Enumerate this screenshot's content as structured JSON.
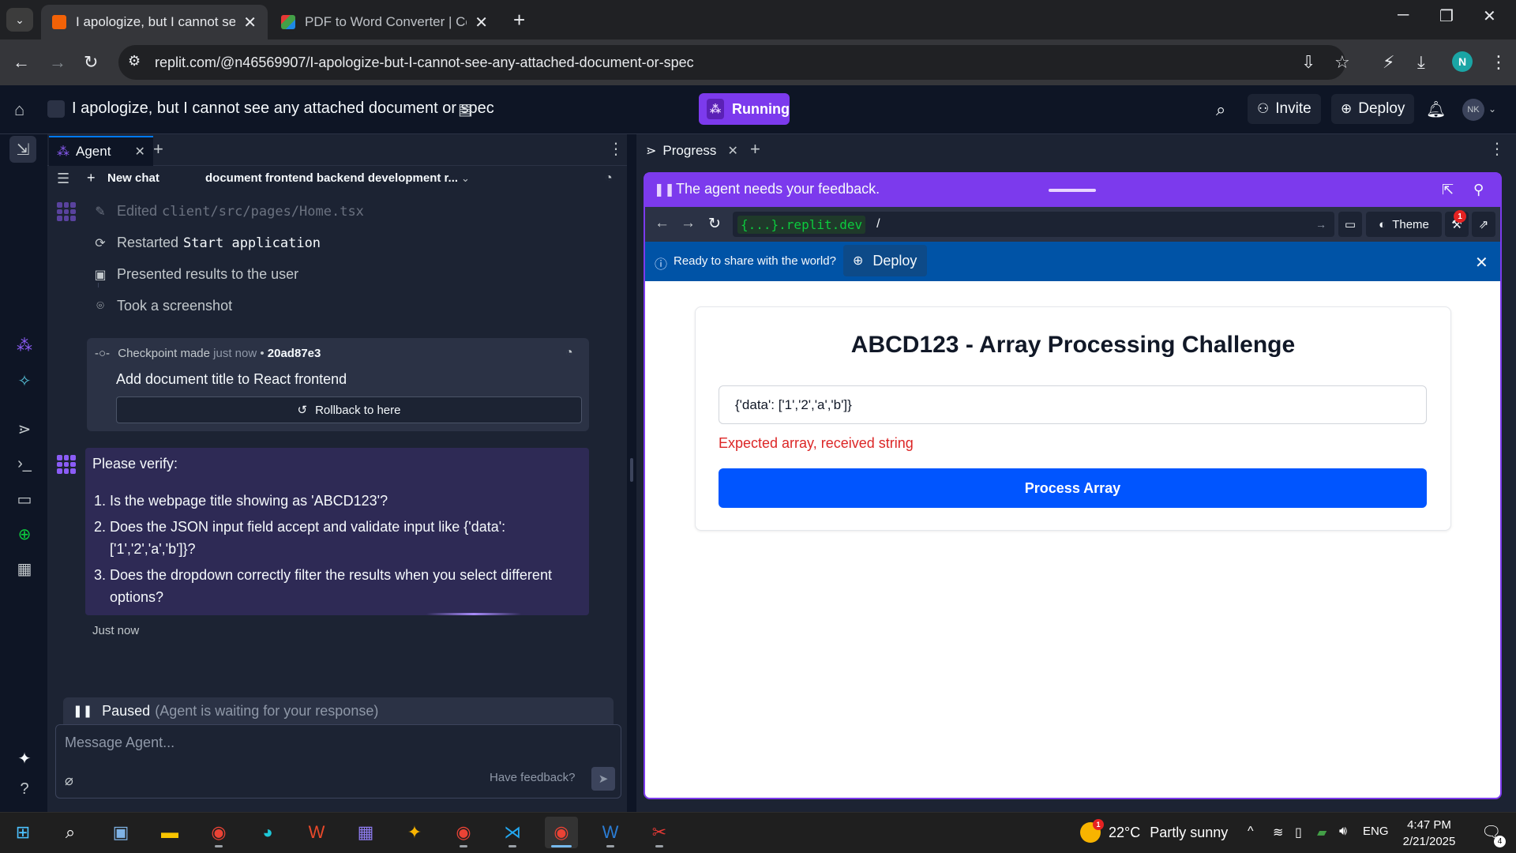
{
  "browser": {
    "tabs": [
      {
        "title": "I apologize, but I cannot see an",
        "active": true
      },
      {
        "title": "PDF to Word Converter | Conve",
        "active": false
      }
    ],
    "url": "replit.com/@n46569907/I-apologize-but-I-cannot-see-any-attached-document-or-spec",
    "profile_initial": "N"
  },
  "header": {
    "repl_title": "I apologize, but I cannot see any attached document or spec",
    "run_label": "Running",
    "invite_label": "Invite",
    "deploy_label": "Deploy",
    "avatar_initials": "NK"
  },
  "agent": {
    "tab_label": "Agent",
    "new_chat_label": "New chat",
    "chat_title": "document frontend backend development r...",
    "activities": [
      {
        "icon": "edit-icon",
        "verb": "Edited",
        "code": "client/src/pages/Home.tsx"
      },
      {
        "icon": "restart-icon",
        "verb": "Restarted",
        "code": "Start application"
      },
      {
        "icon": "present-icon",
        "verb": "Presented results to the user",
        "code": ""
      },
      {
        "icon": "camera-icon",
        "verb": "Took a screenshot",
        "code": ""
      }
    ],
    "checkpoint": {
      "label": "Checkpoint made",
      "time": "just now",
      "separator": "•",
      "hash": "20ad87e3",
      "message": "Add document title to React frontend",
      "rollback_label": "Rollback to here"
    },
    "verify": {
      "title": "Please verify:",
      "items": [
        "Is the webpage title showing as 'ABCD123'?",
        "Does the JSON input field accept and validate input like {'data': ['1','2','a','b']}?",
        "Does the dropdown correctly filter the results when you select different options?"
      ],
      "time": "Just now"
    },
    "paused_label": "Paused",
    "paused_detail": "(Agent is waiting for your response)",
    "message_placeholder": "Message Agent...",
    "feedback_label": "Have feedback?"
  },
  "progress": {
    "tab_label": "Progress",
    "feedback_banner": "The agent needs your feedback.",
    "webview_host": "{...}.replit.dev",
    "webview_path": "/",
    "theme_label": "Theme",
    "badge_count": "1",
    "share_text": "Ready to share with the world?",
    "share_deploy_label": "Deploy"
  },
  "webpage": {
    "title": "ABCD123 - Array Processing Challenge",
    "input_value": "{'data': ['1','2','a','b']}",
    "error": "Expected array, received string",
    "button_label": "Process Array"
  },
  "taskbar": {
    "weather_temp": "22°C",
    "weather_desc": "Partly sunny",
    "weather_badge": "1",
    "language": "ENG",
    "time": "4:47 PM",
    "date": "2/21/2025",
    "notifications": "4"
  },
  "colors": {
    "accent": "#7c3aed",
    "primary_button": "#0055ff",
    "error": "#dc2626",
    "share_bar": "#0053a6",
    "ide_background": "#0e1525",
    "panel": "#1c2333"
  }
}
